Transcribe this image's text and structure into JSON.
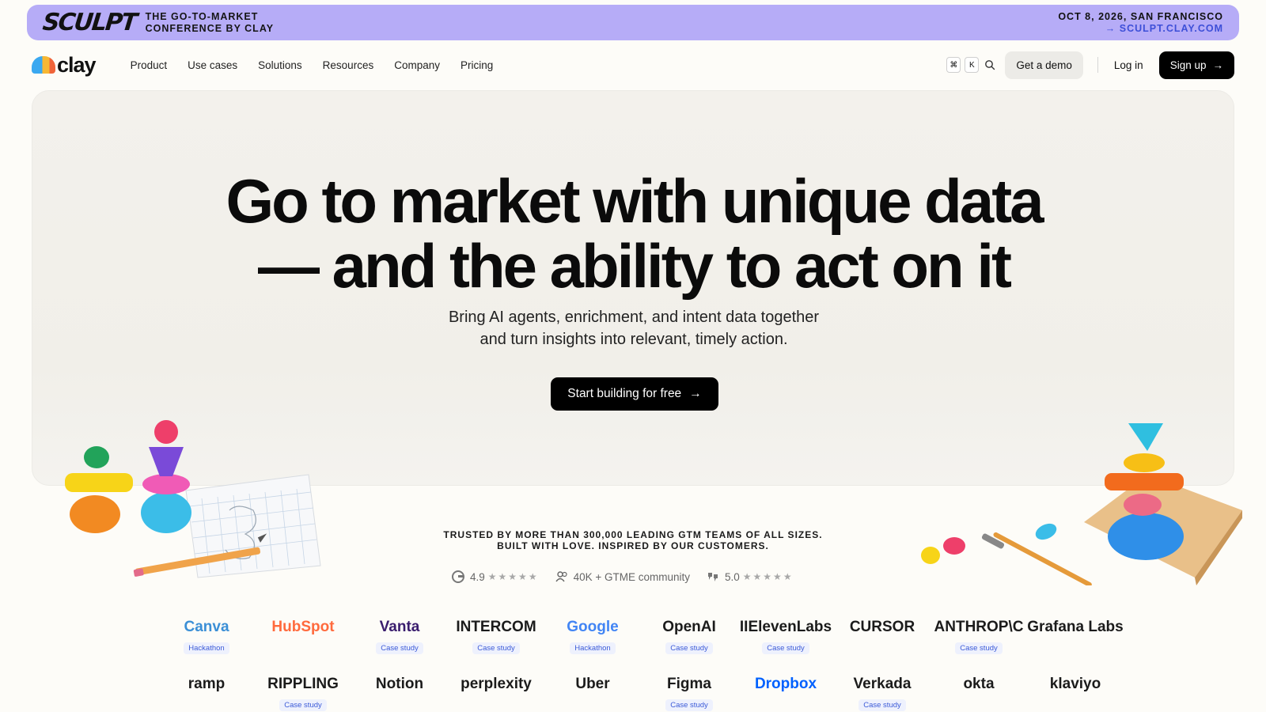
{
  "banner": {
    "logo_text": "SCULPT",
    "left_text_line1": "THE GO-TO-MARKET",
    "left_text_line2": "CONFERENCE BY CLAY",
    "right_line1": "OCT 8, 2026, SAN FRANCISCO",
    "right_link": "→ SCULPT.CLAY.COM"
  },
  "nav": {
    "logo_text": "clay",
    "links": [
      "Product",
      "Use cases",
      "Solutions",
      "Resources",
      "Company",
      "Pricing"
    ],
    "kbd_cmd": "⌘",
    "kbd_k": "K",
    "demo_label": "Get a demo",
    "login_label": "Log in",
    "signup_label": "Sign up"
  },
  "hero": {
    "headline_line1": "Go to market with unique data",
    "headline_line2": "— and the ability to act on it",
    "sub_line1": "Bring AI agents, enrichment, and intent data together",
    "sub_line2": "and turn insights into relevant, timely action.",
    "cta_label": "Start building for free"
  },
  "trust": {
    "line1": "TRUSTED BY MORE THAN 300,000 LEADING GTM TEAMS OF ALL SIZES.",
    "line2": "BUILT WITH LOVE. INSPIRED BY OUR CUSTOMERS.",
    "g2_rating": "4.9",
    "community": "40K + GTME community",
    "tr_rating": "5.0",
    "stars": "★★★★★"
  },
  "logos": {
    "row1": [
      {
        "name": "Canva",
        "tag": "Hackathon",
        "color": "#3b8fd6"
      },
      {
        "name": "HubSpot",
        "tag": "",
        "color": "#ff6a3d"
      },
      {
        "name": "Vanta",
        "tag": "Case study",
        "color": "#3a1d6e"
      },
      {
        "name": "INTERCOM",
        "tag": "Case study",
        "color": "#1b1b1b"
      },
      {
        "name": "Google",
        "tag": "Hackathon",
        "color": "#4285f4"
      },
      {
        "name": "OpenAI",
        "tag": "Case study",
        "color": "#1b1b1b"
      },
      {
        "name": "IIElevenLabs",
        "tag": "Case study",
        "color": "#1b1b1b"
      },
      {
        "name": "CURSOR",
        "tag": "",
        "color": "#1b1b1b"
      },
      {
        "name": "ANTHROP\\C",
        "tag": "Case study",
        "color": "#1b1b1b"
      },
      {
        "name": "Grafana Labs",
        "tag": "",
        "color": "#1b1b1b"
      }
    ],
    "row2": [
      {
        "name": "ramp",
        "tag": "",
        "color": "#1b1b1b"
      },
      {
        "name": "RIPPLING",
        "tag": "Case study",
        "color": "#1b1b1b"
      },
      {
        "name": "Notion",
        "tag": "",
        "color": "#1b1b1b"
      },
      {
        "name": "perplexity",
        "tag": "",
        "color": "#1b1b1b"
      },
      {
        "name": "Uber",
        "tag": "",
        "color": "#1b1b1b"
      },
      {
        "name": "Figma",
        "tag": "Case study",
        "color": "#1b1b1b"
      },
      {
        "name": "Dropbox",
        "tag": "",
        "color": "#0061fe"
      },
      {
        "name": "Verkada",
        "tag": "Case study",
        "color": "#1b1b1b"
      },
      {
        "name": "okta",
        "tag": "",
        "color": "#1b1b1b"
      },
      {
        "name": "klaviyo",
        "tag": "",
        "color": "#1b1b1b"
      }
    ]
  }
}
